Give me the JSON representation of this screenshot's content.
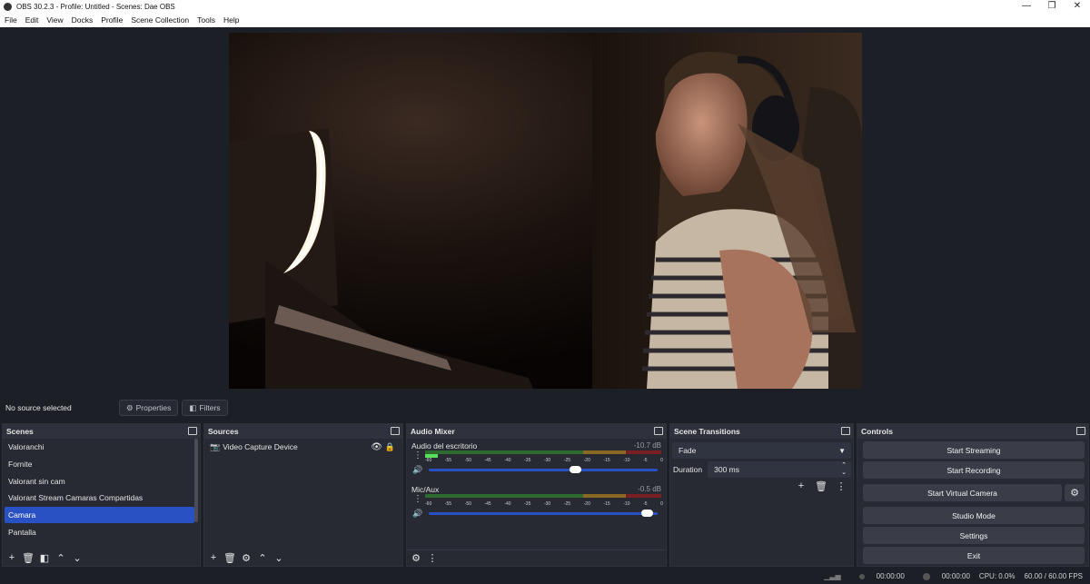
{
  "window": {
    "title": "OBS 30.2.3 - Profile: Untitled - Scenes: Dae OBS",
    "minimize": "—",
    "maximize": "❐",
    "close": "✕"
  },
  "menu": [
    "File",
    "Edit",
    "View",
    "Docks",
    "Profile",
    "Scene Collection",
    "Tools",
    "Help"
  ],
  "source_toolbar": {
    "status": "No source selected",
    "properties": "Properties",
    "filters": "Filters"
  },
  "scenes": {
    "title": "Scenes",
    "items": [
      "Valoranchi",
      "Fornite",
      "Valorant sin cam",
      "Valorant Stream Camaras Compartidas",
      "Camara",
      "Pantalla"
    ],
    "selected_index": 4
  },
  "sources": {
    "title": "Sources",
    "items": [
      {
        "name": "Video Capture Device"
      }
    ]
  },
  "audio_mixer": {
    "title": "Audio Mixer",
    "ticks": [
      "-60",
      "-55",
      "-50",
      "-45",
      "-40",
      "-35",
      "-30",
      "-25",
      "-20",
      "-15",
      "-10",
      "-5",
      "0"
    ],
    "channels": [
      {
        "name": "Audio del escritorio",
        "db": "-10.7 dB",
        "volume": 0.65
      },
      {
        "name": "Mic/Aux",
        "db": "-0.5 dB",
        "volume": 0.98
      }
    ]
  },
  "transitions": {
    "title": "Scene Transitions",
    "selected": "Fade",
    "duration_label": "Duration",
    "duration_value": "300 ms"
  },
  "controls": {
    "title": "Controls",
    "start_streaming": "Start Streaming",
    "start_recording": "Start Recording",
    "start_virtual_camera": "Start Virtual Camera",
    "studio_mode": "Studio Mode",
    "settings": "Settings",
    "exit": "Exit"
  },
  "status": {
    "stream_time": "00:00:00",
    "record_time": "00:00:00",
    "cpu": "CPU: 0.0%",
    "fps": "60.00 / 60.00 FPS"
  },
  "colors": {
    "accent": "#2a51c4",
    "panel": "#272a33",
    "bg": "#1d1f26"
  }
}
